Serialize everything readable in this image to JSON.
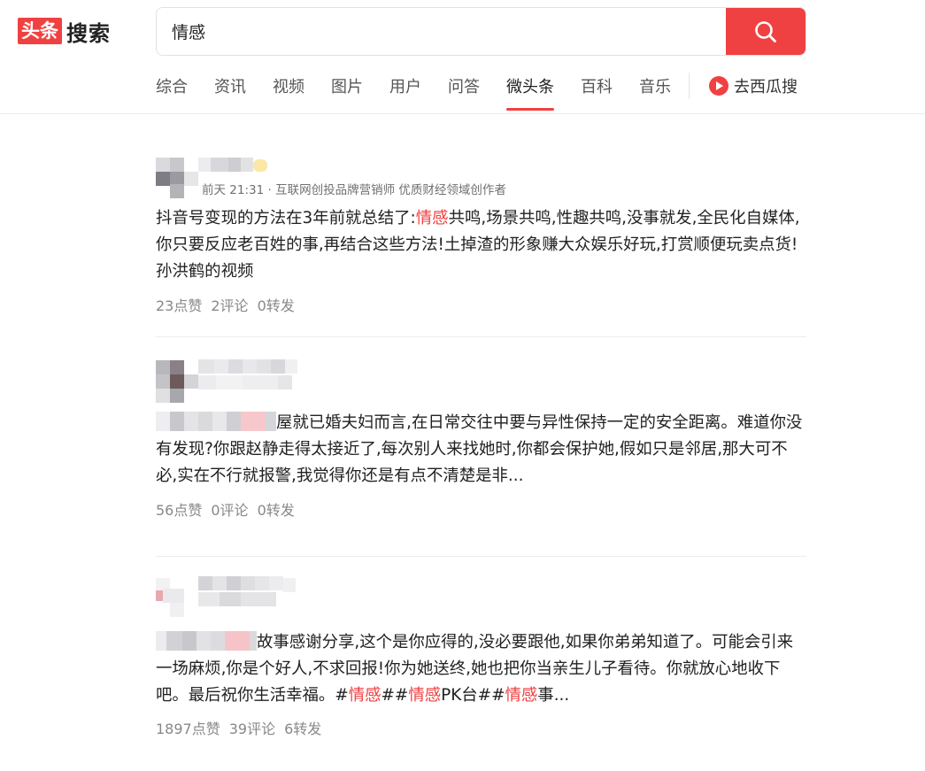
{
  "logo": {
    "box_text": "头条",
    "text": "搜索"
  },
  "search": {
    "value": "情感",
    "button_icon": "search-icon"
  },
  "tabs": [
    {
      "label": "综合",
      "active": false
    },
    {
      "label": "资讯",
      "active": false
    },
    {
      "label": "视频",
      "active": false
    },
    {
      "label": "图片",
      "active": false
    },
    {
      "label": "用户",
      "active": false
    },
    {
      "label": "问答",
      "active": false
    },
    {
      "label": "微头条",
      "active": true
    },
    {
      "label": "百科",
      "active": false
    },
    {
      "label": "音乐",
      "active": false
    }
  ],
  "xigua": {
    "label": "去西瓜搜",
    "icon": "xigua-play-icon"
  },
  "accent_color": "#f04142",
  "results": [
    {
      "meta": "前天 21:31 · 互联网创投品牌营销师 优质财经领域创作者",
      "content": [
        {
          "text": "抖音号变现的方法在3年前就总结了:"
        },
        {
          "text": "情感",
          "hl": true
        },
        {
          "text": "共鸣,场景共鸣,性趣共鸣,没事就发,全民化自媒体,你只要反应老百姓的事,再结合这些方法!土掉渣的形象赚大众娱乐好玩,打赏顺便玩卖点货!孙洪鹤的视频"
        }
      ],
      "stats": {
        "likes": "23点赞",
        "comments": "2评论",
        "shares": "0转发"
      }
    },
    {
      "meta": "",
      "content": [
        {
          "text": "屋就已婚夫妇而言,在日常交往中要与异性保持一定的安全距离。难道你没有发现?你跟赵静走得太接近了,每次别人来找她时,你都会保护她,假如只是邻居,那大可不必,实在不行就报警,我觉得你还是有点不清楚是非..."
        }
      ],
      "stats": {
        "likes": "56点赞",
        "comments": "0评论",
        "shares": "0转发"
      }
    },
    {
      "meta": "",
      "content": [
        {
          "text": "故事感谢分享,这个是你应得的,没必要跟他,如果你弟弟知道了。可能会引来一场麻烦,你是个好人,不求回报!你为她送终,她也把你当亲生儿子看待。你就放心地收下吧。最后祝你生活幸福。#"
        },
        {
          "text": "情感",
          "hl": true
        },
        {
          "text": "##"
        },
        {
          "text": "情感",
          "hl": true
        },
        {
          "text": "PK台##"
        },
        {
          "text": "情感",
          "hl": true
        },
        {
          "text": "事..."
        }
      ],
      "stats": {
        "likes": "1897点赞",
        "comments": "39评论",
        "shares": "6转发"
      }
    }
  ]
}
